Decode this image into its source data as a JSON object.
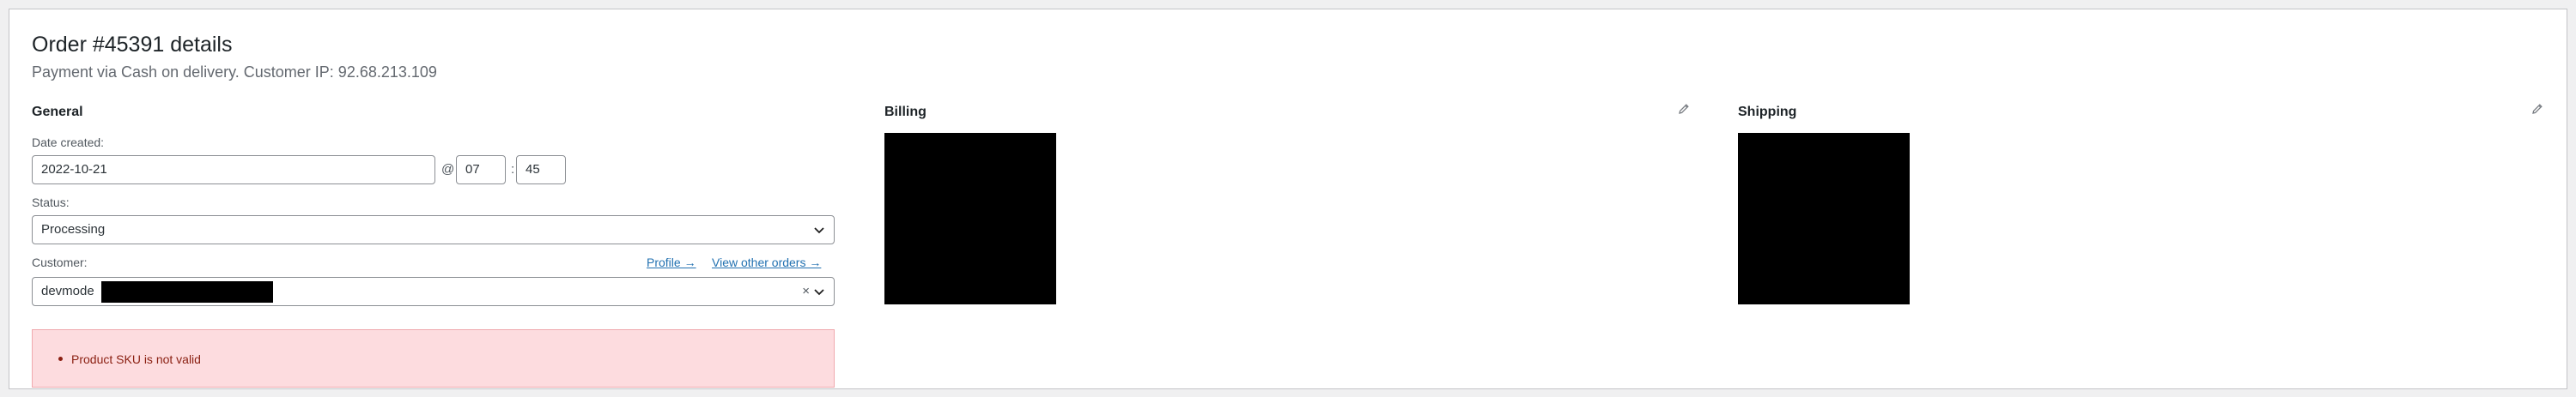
{
  "order": {
    "title": "Order #45391 details",
    "subtitle": "Payment via Cash on delivery. Customer IP: 92.68.213.109"
  },
  "general": {
    "heading": "General",
    "date_created_label": "Date created:",
    "date_value": "2022-10-21",
    "at_symbol": "@",
    "hour_value": "07",
    "colon": ":",
    "minute_value": "45",
    "status_label": "Status:",
    "status_value": "Processing",
    "customer_label": "Customer:",
    "profile_link": "Profile →",
    "view_orders_link": "View other orders →",
    "customer_value": "devmode",
    "clear_symbol": "×"
  },
  "billing": {
    "heading": "Billing"
  },
  "shipping": {
    "heading": "Shipping"
  },
  "notice": {
    "items": [
      "Product SKU is not valid"
    ]
  },
  "icons": {
    "edit": "pencil-icon",
    "dropdown": "chevron-down-icon"
  },
  "colors": {
    "link": "#2271b1",
    "error_bg": "#fddcdf",
    "error_text": "#8a1f11",
    "redacted": "#000000"
  }
}
